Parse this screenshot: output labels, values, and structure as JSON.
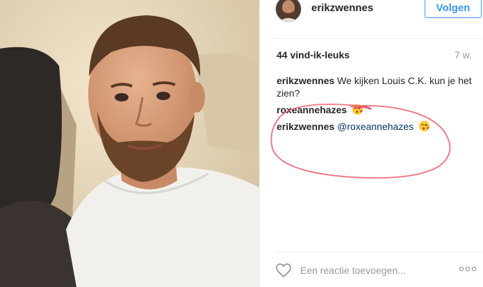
{
  "post": {
    "username": "erikzwennes",
    "follow_label": "Volgen",
    "likes": "44 vind-ik-leuks",
    "time_ago": "7 w."
  },
  "comments": [
    {
      "user": "erikzwennes",
      "text": "We kijken Louis C.K. kun je het zien?"
    },
    {
      "user": "roxeannehazes",
      "text": "",
      "emoji": "kissing-face-emoji"
    },
    {
      "user": "erikzwennes",
      "mention": "@roxeannehazes",
      "emoji": "kissing-face-emoji"
    }
  ],
  "footer": {
    "comment_placeholder": "Een reactie toevoegen...",
    "heart_icon": "heart-outline-icon",
    "more_icon": "more-dots-icon"
  },
  "colors": {
    "follow_blue": "#3897f0",
    "mention_blue": "#003569",
    "annotation_red": "#e85a6a"
  }
}
